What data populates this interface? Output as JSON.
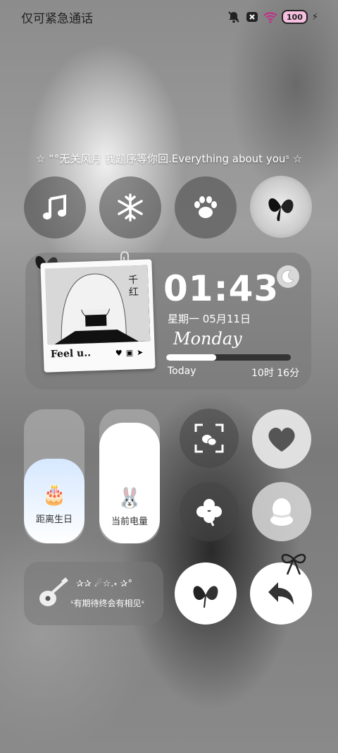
{
  "status_bar": {
    "carrier_text": "仅可紧急通话",
    "battery": "100",
    "icons": [
      "mute-bell-icon",
      "close-icon",
      "wifi-icon",
      "battery-icon",
      "charging-bolt-icon"
    ]
  },
  "quote": "☆ “°无关风月 我题序等你回.Everything about youˢ ☆",
  "shortcuts": [
    {
      "icon": "music-note-icon"
    },
    {
      "icon": "snowflake-icon"
    },
    {
      "icon": "paw-icon"
    },
    {
      "icon": "butterfly-photo-icon"
    }
  ],
  "clock_widget": {
    "photo_caption": "Feel u..",
    "time": "01:43",
    "date": "星期一  05月11日",
    "weekday_script": "Monday",
    "progress_label": "Today",
    "progress_value": 0.4,
    "remaining": "10时 16分"
  },
  "sliders": [
    {
      "label": "距离生日",
      "icon": "birthday-cake-icon",
      "level": 0.63
    },
    {
      "label": "当前电量",
      "icon": "bunny-icon",
      "level": 0.9
    }
  ],
  "quick_buttons": [
    {
      "icon": "wechat-scan-icon"
    },
    {
      "icon": "heart-icon"
    },
    {
      "icon": "clover-icon"
    },
    {
      "icon": "qq-penguin-icon"
    },
    {
      "icon": "butterfly-icon"
    },
    {
      "icon": "back-arrow-icon"
    }
  ],
  "bottom_widget": {
    "stars": "✰✰ ☄☆.˖ ✰°",
    "text": "ˢ有期待终会有相见ˢ",
    "icon": "guitar-icon"
  },
  "colors": {
    "battery_fill": "#f6bfe0",
    "progress_fill": "#ffffff"
  }
}
